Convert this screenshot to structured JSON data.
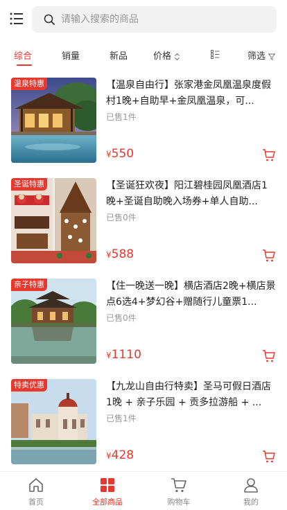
{
  "header": {
    "search_placeholder": "请输入搜索的商品"
  },
  "tabs": [
    {
      "label": "综合",
      "active": true
    },
    {
      "label": "销量"
    },
    {
      "label": "新品"
    },
    {
      "label": "价格"
    },
    {
      "label": ""
    },
    {
      "label": "筛选"
    }
  ],
  "products": [
    {
      "badge": "温泉特惠",
      "title": "【温泉自由行】张家港金凤凰温泉度假村1晚+自助早+金凤凰温泉，可...",
      "sold": "已售1件",
      "currency": "¥",
      "price": "550"
    },
    {
      "badge": "圣诞特惠",
      "title": "【圣诞狂欢夜】阳江碧桂园凤凰酒店1晚+圣诞自助晚入场券+单人自助...",
      "sold": "已售0件",
      "currency": "¥",
      "price": "588"
    },
    {
      "badge": "亲子特惠",
      "title": "【住一晚送一晚】横店酒店2晚+横店景点6选4+梦幻谷+赠随行儿童票1...",
      "sold": "已售0件",
      "currency": "¥",
      "price": "1110"
    },
    {
      "badge": "特卖优惠",
      "title": "【九龙山自由行特卖】圣马可假日酒店1晚 + 亲子乐园 + 贡多拉游船 + ...",
      "sold": "已售1件",
      "currency": "¥",
      "price": "428"
    }
  ],
  "tabbar": [
    {
      "label": "首页",
      "icon": "home-icon"
    },
    {
      "label": "全部商品",
      "icon": "grid-icon",
      "active": true
    },
    {
      "label": "购物车",
      "icon": "cart-icon"
    },
    {
      "label": "我的",
      "icon": "user-icon"
    }
  ],
  "colors": {
    "accent": "#e8372c",
    "search_bg": "#f2f2f2"
  }
}
